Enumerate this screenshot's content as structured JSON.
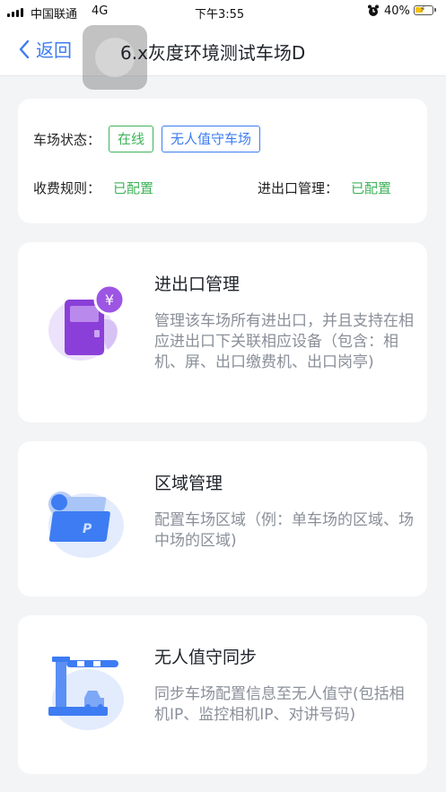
{
  "status_bar": {
    "carrier": "中国联通",
    "network": "4G",
    "time": "下午3:55",
    "battery": "40%",
    "battery_level": 0.4
  },
  "nav": {
    "back_label": "返回",
    "title": "6.x灰度环境测试车场D"
  },
  "status_card": {
    "lot_status_label": "车场状态：",
    "online_tag": "在线",
    "unattended_tag": "无人值守车场",
    "fee_rule_label": "收费规则：",
    "fee_rule_value": "已配置",
    "gate_mgmt_label": "进出口管理：",
    "gate_mgmt_value": "已配置"
  },
  "features": [
    {
      "title": "进出口管理",
      "description": "管理该车场所有进出口，并且支持在相应进出口下关联相应设备（包含：相机、屏、出口缴费机、出口岗亭)",
      "icon": "gate-terminal-icon"
    },
    {
      "title": "区域管理",
      "description": "配置车场区域（例：单车场的区域、场中场的区域)",
      "icon": "parking-area-icon"
    },
    {
      "title": "无人值守同步",
      "description": "同步车场配置信息至无人值守(包括相机IP、监控相机IP、对讲号码)",
      "icon": "barrier-gate-icon"
    }
  ],
  "colors": {
    "accent_blue": "#3d7cf2",
    "status_green": "#3fb35a",
    "purple": "#8b3fd9",
    "background": "#f3f4f6"
  }
}
